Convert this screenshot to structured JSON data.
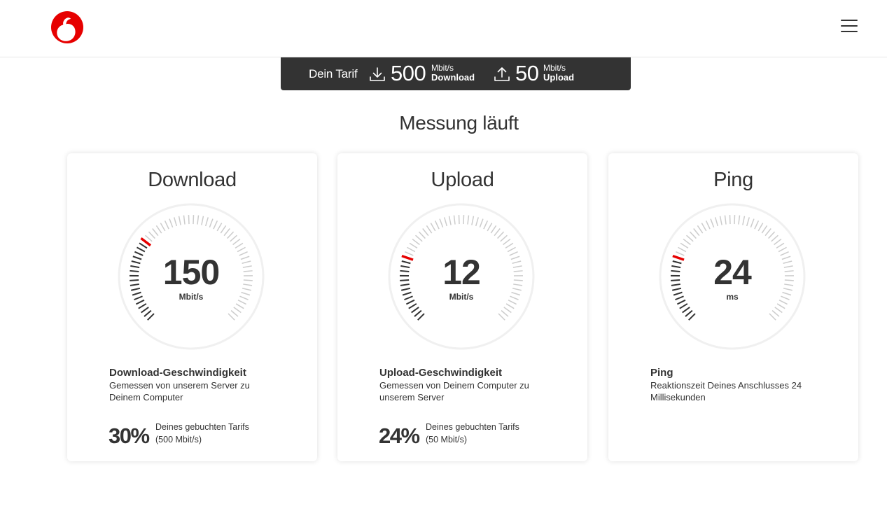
{
  "header": {
    "logo_icon": "vodafone-speechmark-logo",
    "menu_icon": "hamburger-menu-icon",
    "brand_color": "#e60000"
  },
  "tariff": {
    "label": "Dein Tarif",
    "download": {
      "value": "500",
      "unit": "Mbit/s",
      "label": "Download",
      "icon": "download-arrow-icon"
    },
    "upload": {
      "value": "50",
      "unit": "Mbit/s",
      "label": "Upload",
      "icon": "upload-arrow-icon"
    }
  },
  "page_title": "Messung läuft",
  "cards": [
    {
      "title": "Download",
      "gauge_value": "150",
      "gauge_unit": "Mbit/s",
      "gauge_fraction": 0.3,
      "desc_title": "Download-Geschwindigkeit",
      "desc_text": "Gemessen von unserem Server zu Deinem Computer",
      "percent": "30%",
      "percent_text_1": "Deines gebuchten Tarifs",
      "percent_text_2": "(500 Mbit/s)"
    },
    {
      "title": "Upload",
      "gauge_value": "12",
      "gauge_unit": "Mbit/s",
      "gauge_fraction": 0.24,
      "desc_title": "Upload-Geschwindigkeit",
      "desc_text": "Gemessen von Deinem Computer zu unserem Server",
      "percent": "24%",
      "percent_text_1": "Deines gebuchten Tarifs",
      "percent_text_2": "(50 Mbit/s)"
    },
    {
      "title": "Ping",
      "gauge_value": "24",
      "gauge_unit": "ms",
      "gauge_fraction": 0.24,
      "desc_title": "Ping",
      "desc_text": "Reaktionszeit Deines Anschlusses 24 Millisekunden"
    }
  ],
  "colors": {
    "accent": "#e60000",
    "tick_active": "#333333",
    "tick_inactive": "#cccccc",
    "tariff_bar": "#333333"
  }
}
